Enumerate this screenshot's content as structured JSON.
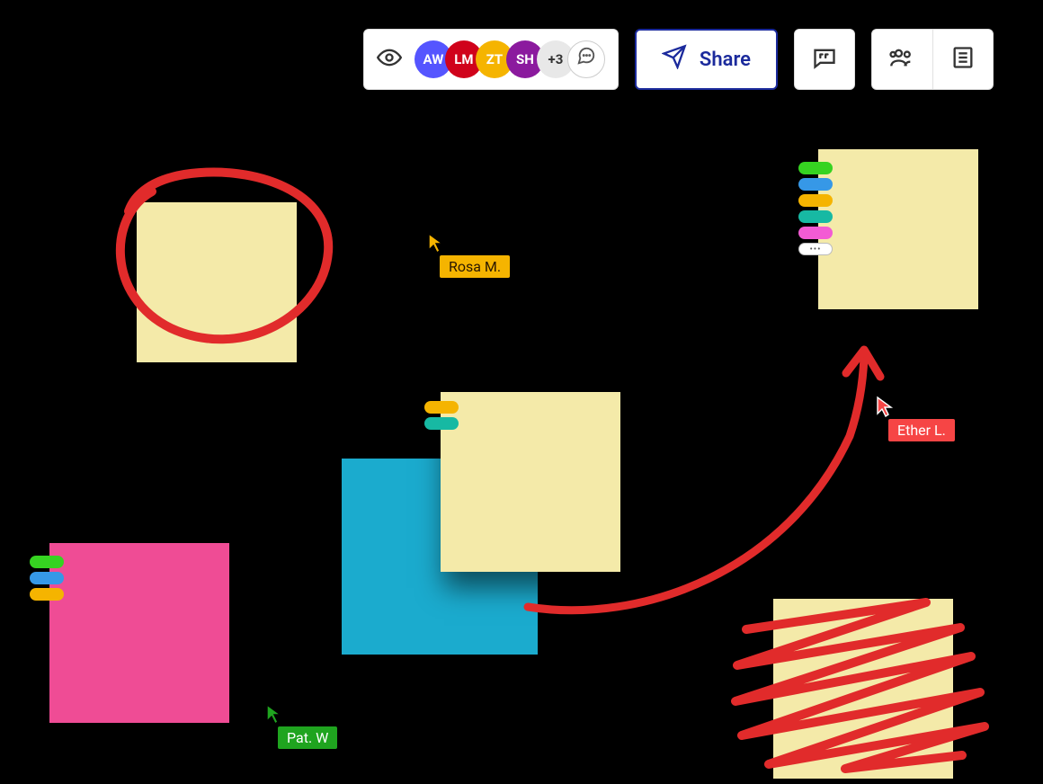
{
  "toolbar": {
    "share_label": "Share",
    "avatars": [
      {
        "initials": "AW",
        "color": "#5555ff"
      },
      {
        "initials": "LM",
        "color": "#d0021b"
      },
      {
        "initials": "ZT",
        "color": "#f5b400"
      },
      {
        "initials": "SH",
        "color": "#8b1a9e"
      }
    ],
    "more_count": "+3"
  },
  "collaborators": {
    "rosa": {
      "name": "Rosa M.",
      "color": "#f5b400"
    },
    "pat": {
      "name": "Pat. W",
      "color": "#1fa41f"
    },
    "ether": {
      "name": "Ether L.",
      "color": "#f64545"
    }
  },
  "colors": {
    "ink": "#e12b2b",
    "bg": "#000000"
  },
  "tags": {
    "palette": [
      "#36d321",
      "#3698e7",
      "#f5b400",
      "#17b9a3",
      "#f35bd4"
    ]
  }
}
